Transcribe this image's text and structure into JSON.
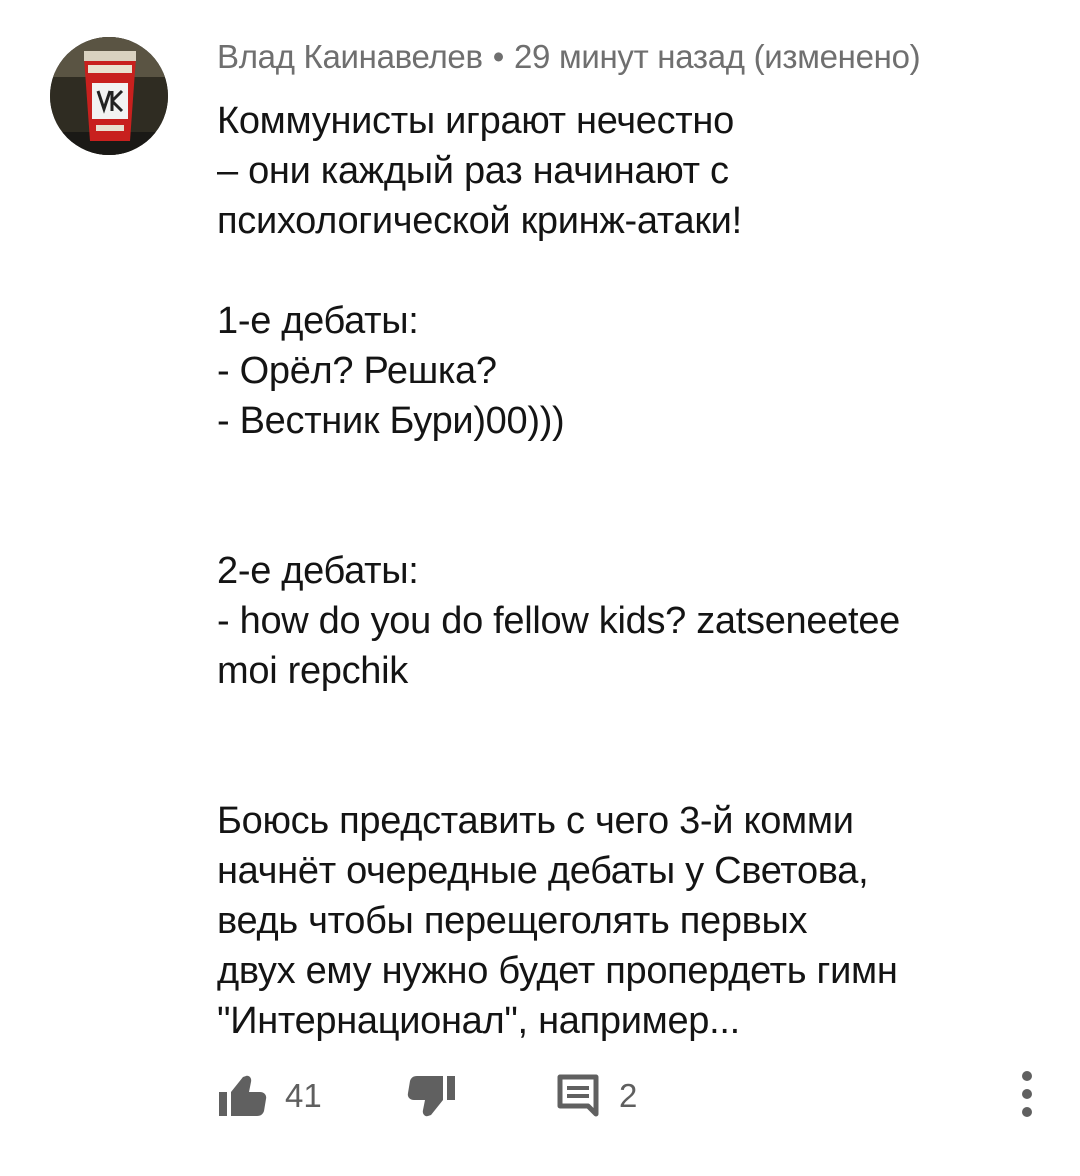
{
  "comment": {
    "author": "Влад Каинавелев",
    "separator": "•",
    "time": "29 минут назад (изменено)",
    "text": "Коммунисты играют нечестно\n– они каждый раз начинают с\nпсихологической кринж-атаки!\n\n1-е дебаты:\n- Орёл? Решка?\n- Вестник Бури)00)))\n\n\n2-е дебаты:\n- how do you do fellow kids? zatseneetee\nmoi repchik\n\n\nБоюсь представить с чего 3-й комми\nначнёт очередные дебаты у Светова,\nведь чтобы  перещеголять первых\nдвух ему нужно будет пропердеть гимн\n\"Интернационал\", например..."
  },
  "actions": {
    "likes": "41",
    "replies": "2"
  },
  "icons": {
    "avatar": "avatar-image",
    "like": "thumbs-up-icon",
    "dislike": "thumbs-down-icon",
    "reply": "comment-icon",
    "more": "more-vertical-icon"
  },
  "colors": {
    "text": "#141414",
    "meta": "#6f6f6f",
    "icon": "#606060",
    "avatar_accent": "#c8201e"
  }
}
